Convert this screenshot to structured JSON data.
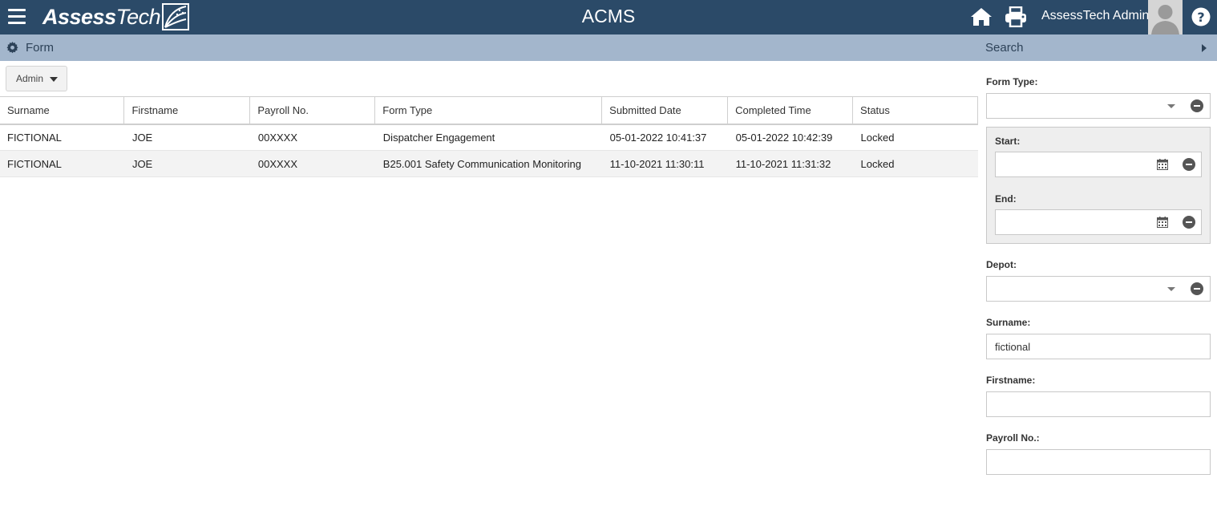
{
  "header": {
    "logo_bold": "Assess",
    "logo_light": "Tech",
    "app_title": "ACMS",
    "user_name": "AssessTech Admin",
    "icons": [
      "menu-icon",
      "home-icon",
      "print-icon",
      "avatar-icon",
      "help-icon"
    ]
  },
  "subheader": {
    "form_label": "Form",
    "search_label": "Search"
  },
  "toolbar": {
    "admin_label": "Admin"
  },
  "table": {
    "columns": [
      "Surname",
      "Firstname",
      "Payroll No.",
      "Form Type",
      "Submitted Date",
      "Completed Time",
      "Status"
    ],
    "rows": [
      [
        "FICTIONAL",
        "JOE",
        "00XXXX",
        "Dispatcher Engagement",
        "05-01-2022 10:41:37",
        "05-01-2022 10:42:39",
        "Locked"
      ],
      [
        "FICTIONAL",
        "JOE",
        "00XXXX",
        "B25.001 Safety Communication Monitoring",
        "11-10-2021 11:30:11",
        "11-10-2021 11:31:32",
        "Locked"
      ]
    ]
  },
  "search": {
    "form_type_label": "Form Type:",
    "form_type_value": "",
    "start_label": "Start:",
    "start_value": "",
    "end_label": "End:",
    "end_value": "",
    "depot_label": "Depot:",
    "depot_value": "",
    "surname_label": "Surname:",
    "surname_value": "fictional",
    "firstname_label": "Firstname:",
    "firstname_value": "",
    "payroll_label": "Payroll No.:",
    "payroll_value": ""
  },
  "colors": {
    "topbar": "#2b4a68",
    "subbar": "#a3b6cc"
  }
}
